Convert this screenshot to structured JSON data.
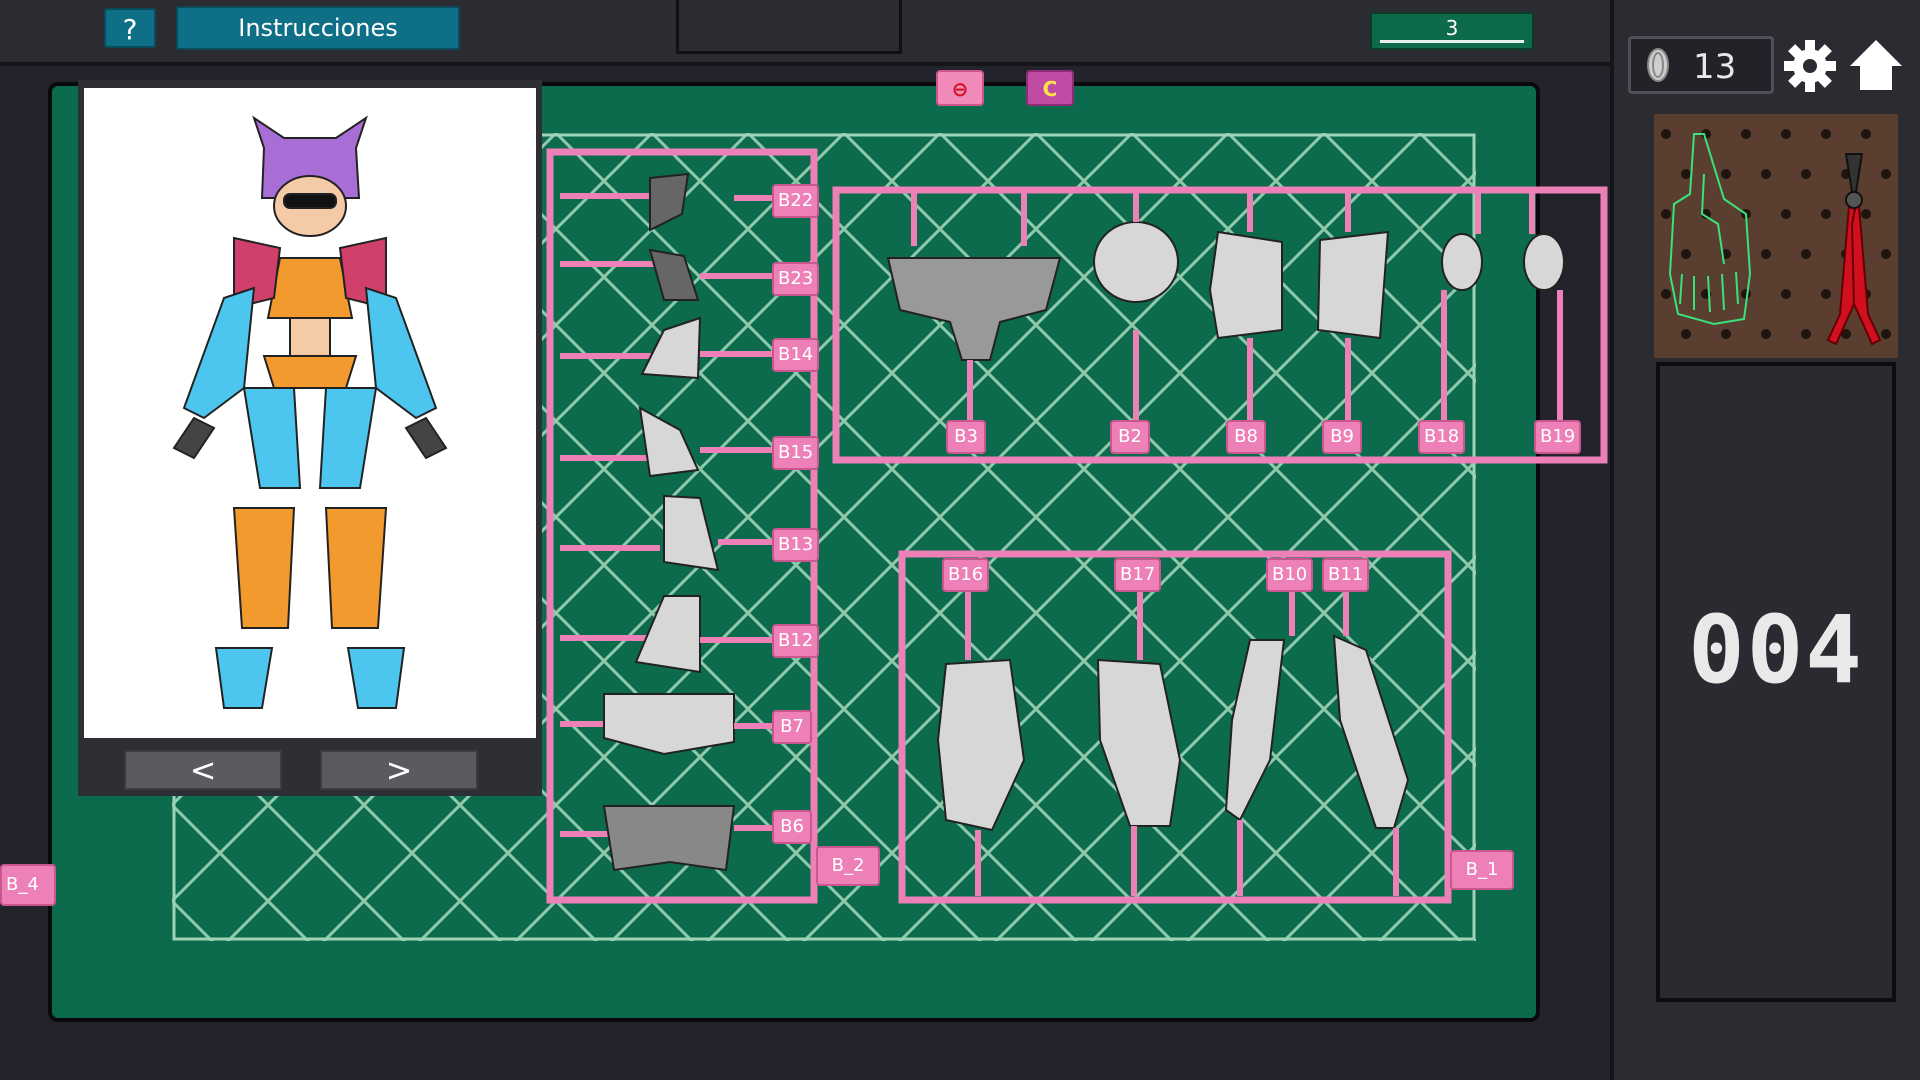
{
  "topbar": {
    "help_label": "?",
    "instructions_label": "Instrucciones",
    "counter_value": "3"
  },
  "sidebar": {
    "coin_count": "13",
    "code": "004"
  },
  "preview": {
    "prev_label": "<",
    "next_label": ">"
  },
  "tags": {
    "top_left_glyph": "⊖",
    "top_right_glyph": "C",
    "side": "B_4"
  },
  "sprue_labels": {
    "left": [
      "B22",
      "B23",
      "B14",
      "B15",
      "B13",
      "B12",
      "B7",
      "B6"
    ],
    "left_frame": "B_2",
    "top": [
      "B3",
      "B2",
      "B8",
      "B9",
      "B18",
      "B19"
    ],
    "bottom": [
      "B16",
      "B17",
      "B10",
      "B11"
    ],
    "bottom_frame": "B_1"
  },
  "colors": {
    "board": "#0c6b4c",
    "sprue": "#ee80b8",
    "button": "#0f6f86"
  },
  "icons": [
    "help-icon",
    "coin-icon",
    "gear-icon",
    "home-icon",
    "glove-icon",
    "pliers-icon"
  ]
}
